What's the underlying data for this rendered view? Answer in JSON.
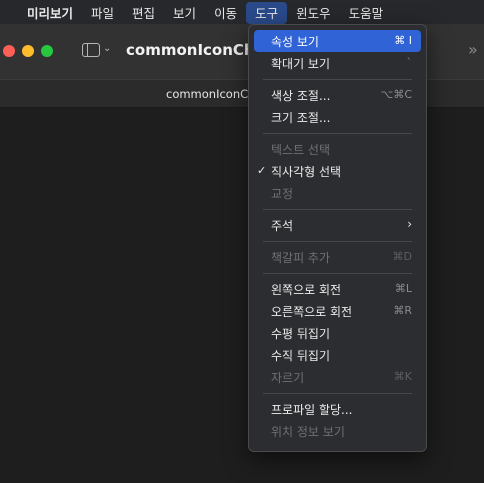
{
  "menubar": {
    "apple_icon": "apple-icon",
    "items": [
      {
        "label": "미리보기"
      },
      {
        "label": "파일"
      },
      {
        "label": "편집"
      },
      {
        "label": "보기"
      },
      {
        "label": "이동"
      },
      {
        "label": "도구"
      },
      {
        "label": "윈도우"
      },
      {
        "label": "도움말"
      }
    ]
  },
  "window": {
    "title": "commonIconChe",
    "tab_title": "commonIconCh",
    "overflow": "»"
  },
  "dropdown": {
    "items": [
      {
        "label": "속성 보기",
        "shortcut": "⌘ I"
      },
      {
        "label": "확대기 보기",
        "shortcut": "`"
      },
      {
        "label": "색상 조절...",
        "shortcut": "⌥⌘C"
      },
      {
        "label": "크기 조절..."
      },
      {
        "label": "텍스트 선택"
      },
      {
        "label": "직사각형 선택",
        "check": "✓"
      },
      {
        "label": "교정"
      },
      {
        "label": "주석",
        "arrow": "›"
      },
      {
        "label": "책갈피 추가",
        "shortcut": "⌘D"
      },
      {
        "label": "왼쪽으로 회전",
        "shortcut": "⌘L"
      },
      {
        "label": "오른쪽으로 회전",
        "shortcut": "⌘R"
      },
      {
        "label": "수평 뒤집기"
      },
      {
        "label": "수직 뒤집기"
      },
      {
        "label": "자르기",
        "shortcut": "⌘K"
      },
      {
        "label": "프로파일 할당..."
      },
      {
        "label": "위치 정보 보기"
      }
    ]
  }
}
